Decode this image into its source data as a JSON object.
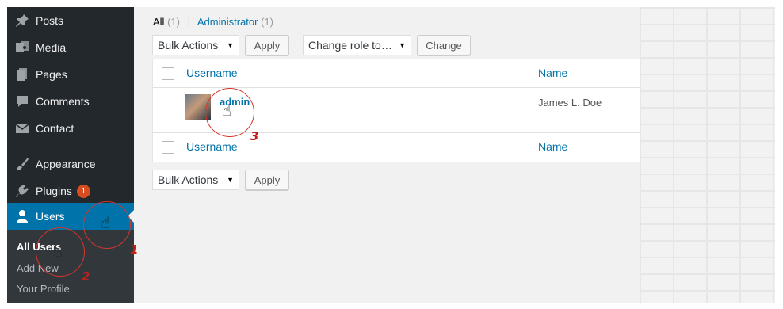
{
  "sidebar": {
    "items": [
      {
        "label": "Posts",
        "icon": "pin-icon"
      },
      {
        "label": "Media",
        "icon": "media-icon"
      },
      {
        "label": "Pages",
        "icon": "pages-icon"
      },
      {
        "label": "Comments",
        "icon": "comment-icon"
      },
      {
        "label": "Contact",
        "icon": "envelope-icon"
      },
      {
        "label": "Appearance",
        "icon": "brush-icon"
      },
      {
        "label": "Plugins",
        "icon": "plug-icon",
        "badge": "1"
      },
      {
        "label": "Users",
        "icon": "user-icon",
        "active": true
      }
    ],
    "submenu": [
      "All Users",
      "Add New",
      "Your Profile"
    ]
  },
  "filters": {
    "all_label": "All",
    "all_count": "(1)",
    "separator": "|",
    "admin_label": "Administrator",
    "admin_count": "(1)"
  },
  "toolbar": {
    "bulk_actions": "Bulk Actions",
    "apply": "Apply",
    "change_role": "Change role to…",
    "change": "Change"
  },
  "table": {
    "col_username": "Username",
    "col_name": "Name",
    "rows": [
      {
        "username": "admin",
        "name": "James L. Doe"
      }
    ]
  },
  "bottom_toolbar": {
    "bulk_actions": "Bulk Actions",
    "apply": "Apply"
  },
  "annotations": {
    "step1": "1",
    "step2": "2",
    "step3": "3"
  },
  "colors": {
    "sidebar_bg": "#23282d",
    "active_bg": "#0073aa",
    "link": "#0073aa",
    "annotation": "#d9352a"
  }
}
